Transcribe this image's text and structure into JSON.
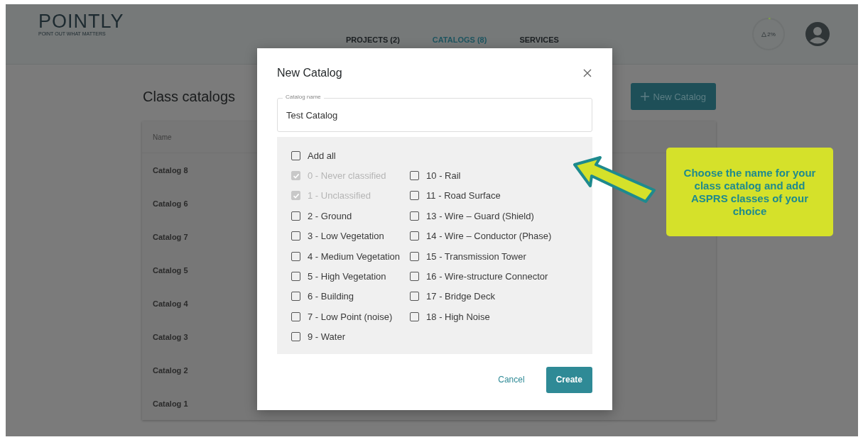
{
  "header": {
    "logo": "POINTLY",
    "tagline": "POINT OUT WHAT MATTERS",
    "nav": [
      {
        "label": "PROJECTS (2)",
        "selected": false
      },
      {
        "label": "CATALOGS (8)",
        "selected": true
      },
      {
        "label": "SERVICES",
        "selected": false
      }
    ],
    "usage": {
      "text": "2%",
      "level": 0.02
    }
  },
  "page": {
    "title": "Class catalogs",
    "new_button": "New Catalog",
    "table": {
      "column": "Name",
      "rows": [
        "Catalog 8",
        "Catalog 6",
        "Catalog 7",
        "Catalog 5",
        "Catalog 4",
        "Catalog 3",
        "Catalog 2",
        "Catalog 1"
      ]
    }
  },
  "dialog": {
    "title": "New Catalog",
    "field": {
      "label": "Catalog name",
      "value": "Test Catalog"
    },
    "add_all": {
      "label": "Add all",
      "checked": false
    },
    "classes_left": [
      {
        "label": "0 - Never classified",
        "checked": true,
        "disabled": true
      },
      {
        "label": "1 - Unclassified",
        "checked": true,
        "disabled": true
      },
      {
        "label": "2 - Ground",
        "checked": false,
        "disabled": false
      },
      {
        "label": "3 - Low Vegetation",
        "checked": false,
        "disabled": false
      },
      {
        "label": "4 - Medium Vegetation",
        "checked": false,
        "disabled": false
      },
      {
        "label": "5 - High Vegetation",
        "checked": false,
        "disabled": false
      },
      {
        "label": "6 - Building",
        "checked": false,
        "disabled": false
      },
      {
        "label": "7 - Low Point (noise)",
        "checked": false,
        "disabled": false
      },
      {
        "label": "9 - Water",
        "checked": false,
        "disabled": false
      }
    ],
    "classes_right": [
      {
        "label": "10 - Rail",
        "checked": false,
        "disabled": false
      },
      {
        "label": "11 - Road Surface",
        "checked": false,
        "disabled": false
      },
      {
        "label": "13 - Wire – Guard (Shield)",
        "checked": false,
        "disabled": false
      },
      {
        "label": "14 - Wire – Conductor (Phase)",
        "checked": false,
        "disabled": false
      },
      {
        "label": "15 - Transmission Tower",
        "checked": false,
        "disabled": false
      },
      {
        "label": "16 - Wire-structure Connector",
        "checked": false,
        "disabled": false
      },
      {
        "label": "17 - Bridge Deck",
        "checked": false,
        "disabled": false
      },
      {
        "label": "18 - High Noise",
        "checked": false,
        "disabled": false
      }
    ],
    "cancel": "Cancel",
    "create": "Create"
  },
  "callout": "Choose the name for your class catalog and add ASPRS classes of your choice"
}
